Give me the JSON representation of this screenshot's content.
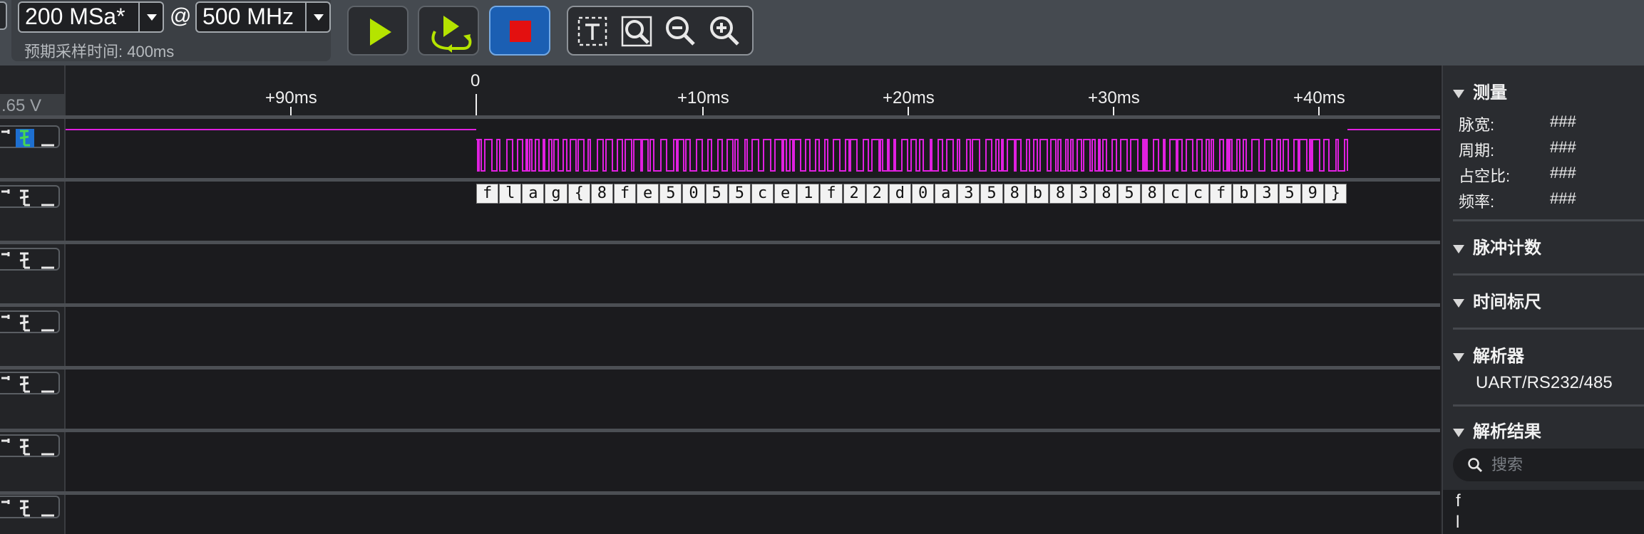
{
  "toolbar": {
    "sample_rate": "200 MSa*",
    "at_symbol": "@",
    "frequency": "500 MHz",
    "estimated_time": "预期采样时间: 400ms",
    "buttons": {
      "run": "play-icon",
      "loop": "loop-play-icon",
      "stop": "stop-icon"
    },
    "zoom_tools": [
      "text-select-icon",
      "zoom-area-icon",
      "zoom-out-icon",
      "zoom-in-icon"
    ],
    "colors": {
      "run": "#b5e400",
      "stop_bg": "#1b5fb3",
      "stop_square": "#e31010"
    }
  },
  "channels": {
    "voltage": ".65 V",
    "count": 7,
    "active_channel_color": "#e020e0"
  },
  "timeline": {
    "ticks": [
      "+90ms",
      "0",
      "+10ms",
      "+20ms",
      "+30ms",
      "+40ms"
    ]
  },
  "decoded": [
    "f",
    "l",
    "a",
    "g",
    "{",
    "8",
    "f",
    "e",
    "5",
    "0",
    "5",
    "5",
    "c",
    "e",
    "1",
    "f",
    "2",
    "2",
    "d",
    "0",
    "a",
    "3",
    "5",
    "8",
    "b",
    "8",
    "3",
    "8",
    "5",
    "8",
    "c",
    "c",
    "f",
    "b",
    "3",
    "5",
    "9",
    "}"
  ],
  "sidebar": {
    "measure": {
      "title": "测量",
      "rows": [
        {
          "label": "脉宽:",
          "value": "###"
        },
        {
          "label": "周期:",
          "value": "###"
        },
        {
          "label": "占空比:",
          "value": "###"
        },
        {
          "label": "频率:",
          "value": "###"
        }
      ]
    },
    "pulse_count": {
      "title": "脉冲计数"
    },
    "time_ruler": {
      "title": "时间标尺"
    },
    "analyzer": {
      "title": "解析器",
      "decoder": "UART/RS232/485"
    },
    "results": {
      "title": "解析结果",
      "search_placeholder": "搜索",
      "items": [
        "f",
        "l"
      ]
    }
  }
}
